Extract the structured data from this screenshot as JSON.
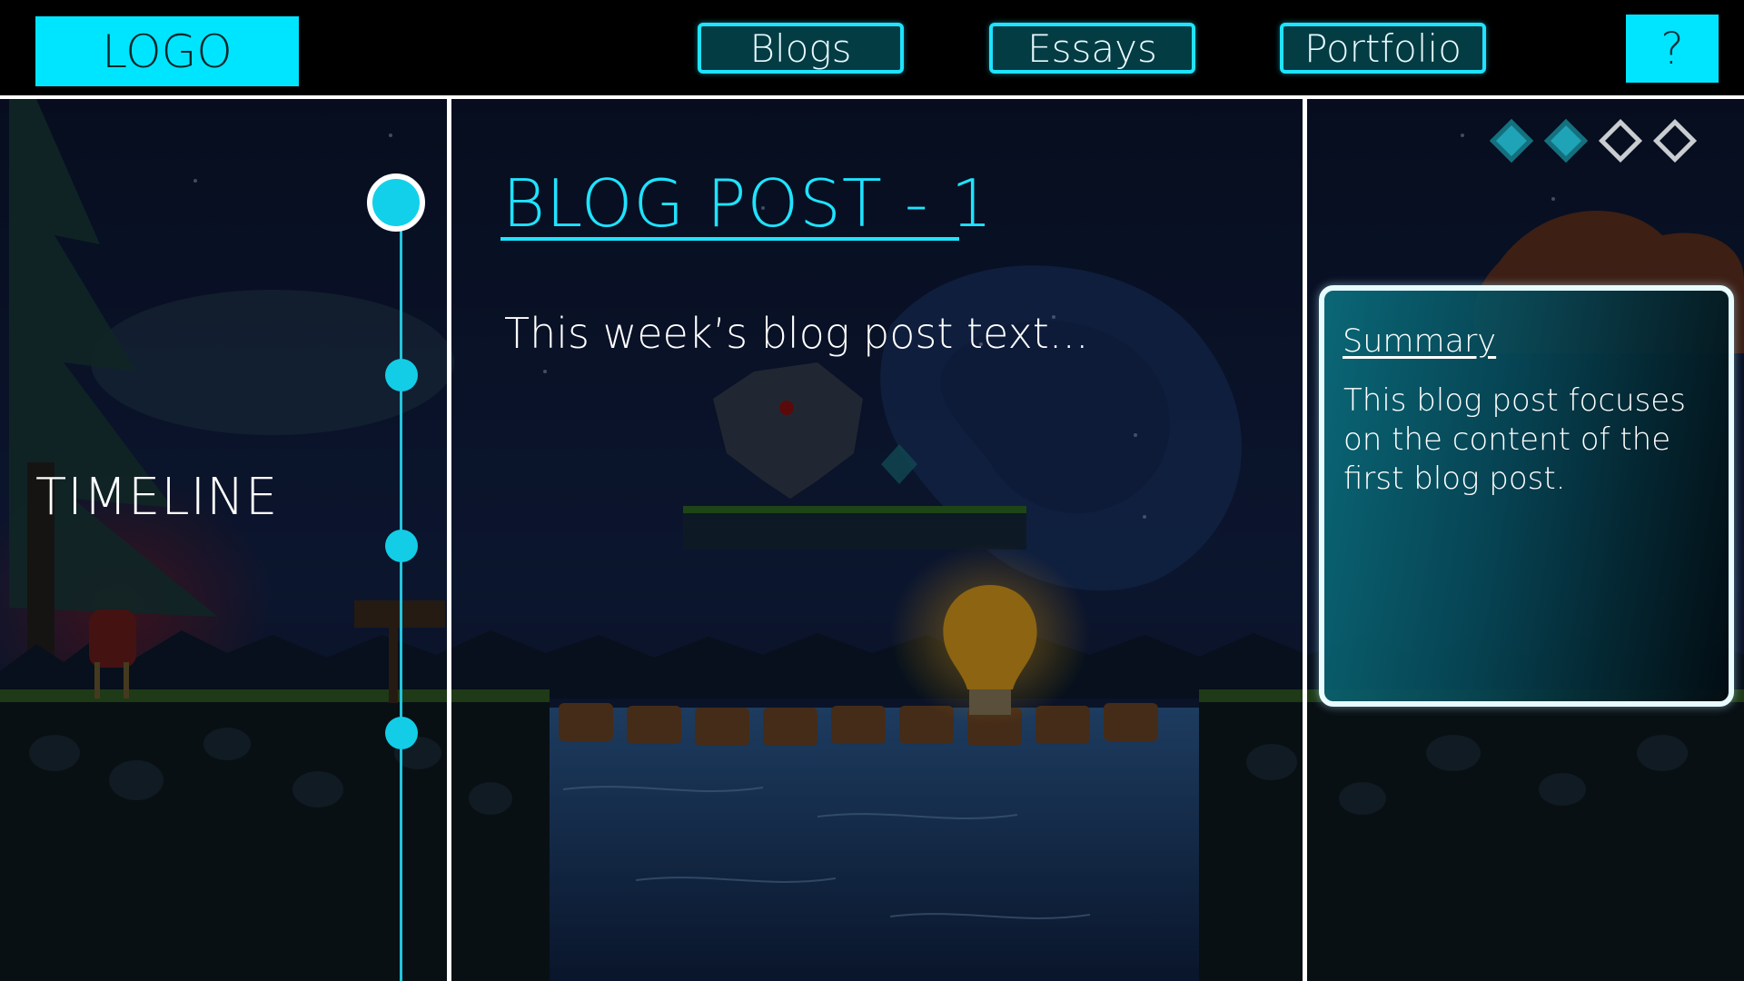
{
  "header": {
    "logo": "LOGO",
    "nav": [
      "Blogs",
      "Essays",
      "Portfolio"
    ],
    "help": "?"
  },
  "timeline": {
    "label": "TIMELINE",
    "nodes": 4,
    "active_index": 0
  },
  "post": {
    "title": "BLOG POST - 1",
    "text": "This week’s blog post text..."
  },
  "progress": {
    "total": 4,
    "completed": 2
  },
  "summary": {
    "heading": "Summary",
    "body": "This blog post focuses on the content of the first blog post."
  },
  "colors": {
    "accent": "#00e5ff",
    "nav_fill": "#043c44",
    "background": "#000000"
  }
}
